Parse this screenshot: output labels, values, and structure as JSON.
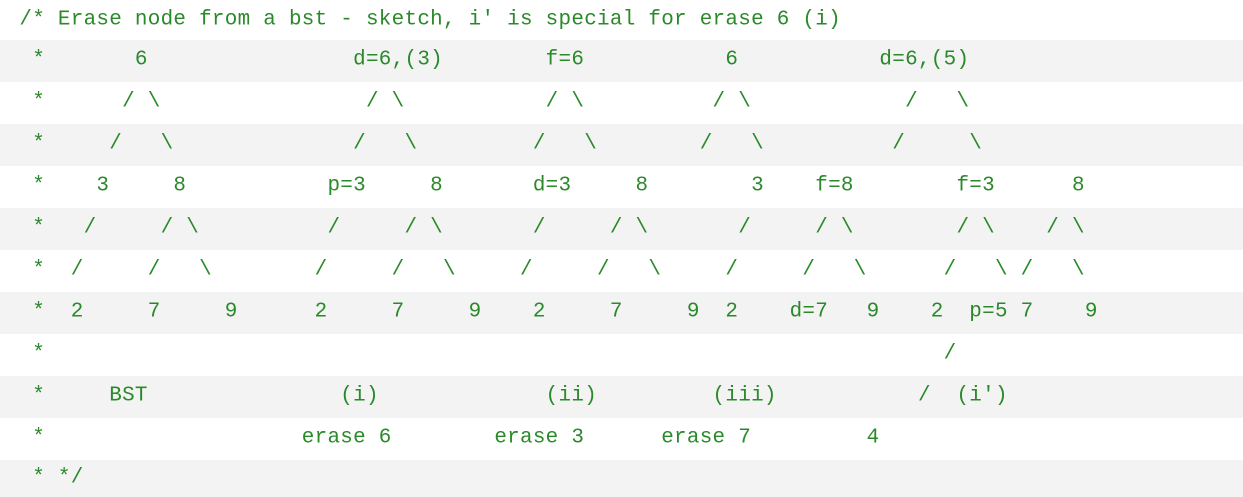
{
  "code_comment": {
    "text_color": "#2a8a2a",
    "shaded_row_color": "#f3f3f3",
    "lines": [
      "/* Erase node from a bst - sketch, i' is special for erase 6 (i)",
      " *       6                d=6,(3)        f=6           6           d=6,(5)",
      " *      / \\                / \\           / \\          / \\            /   \\",
      " *     /   \\              /   \\         /   \\        /   \\          /     \\",
      " *    3     8           p=3     8       d=3     8        3    f=8        f=3      8",
      " *   /     / \\          /     / \\       /     / \\       /     / \\        / \\    / \\",
      " *  /     /   \\        /     /   \\     /     /   \\     /     /   \\      /   \\ /   \\",
      " *  2     7     9      2     7     9    2     7     9  2    d=7   9    2  p=5 7    9",
      " *                                                                      /",
      " *     BST               (i)             (ii)         (iii)           /  (i')",
      " *                    erase 6        erase 3      erase 7         4",
      " * */"
    ]
  }
}
